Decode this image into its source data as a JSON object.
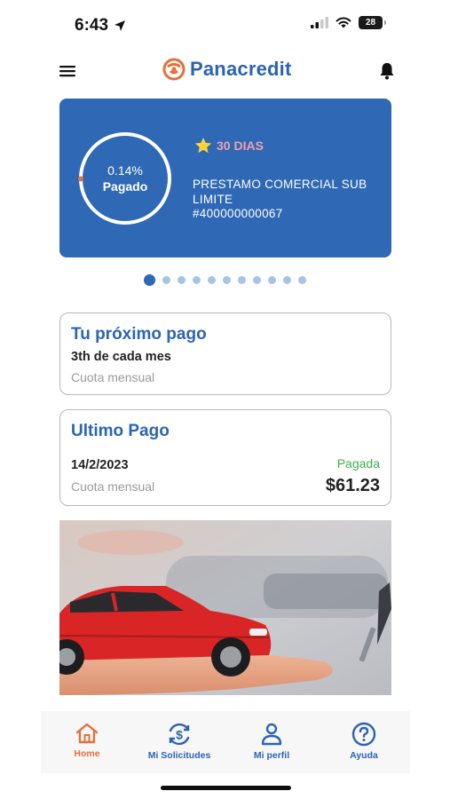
{
  "status_bar": {
    "time": "6:43",
    "battery": "28",
    "icons": [
      "location-arrow-icon",
      "signal-icon",
      "wifi-icon",
      "battery-icon"
    ]
  },
  "header": {
    "brand": "Panacredit",
    "menu_icon": "hamburger-menu-icon",
    "bell_icon": "bell-icon",
    "brand_color": "#2b64b3",
    "logo_color": "#e4703a"
  },
  "loan_card": {
    "percent_text": "0.14%",
    "progress_fraction": 0.0014,
    "status": "Pagado",
    "days": "30 DIAS",
    "name": "PRESTAMO COMERCIAL SUB LIMITE",
    "number": "#400000000067",
    "background": "#2f68b4"
  },
  "carousel": {
    "total": 11,
    "active_index": 0
  },
  "next_payment": {
    "title": "Tu próximo pago",
    "date_text": "3th de cada mes",
    "subtitle": "Cuota mensual"
  },
  "last_payment": {
    "title": "Ultimo Pago",
    "date": "14/2/2023",
    "subtitle": "Cuota mensual",
    "status": "Pagada",
    "amount": "$61.23",
    "status_color": "#3fae49"
  },
  "banner": {
    "image": "red-car-on-hand-photo"
  },
  "bottom_nav": {
    "items": [
      {
        "label": "Home",
        "icon": "home-icon",
        "active": true
      },
      {
        "label": "Mi Solicitudes",
        "icon": "dollar-refresh-icon",
        "active": false
      },
      {
        "label": "Mi perfil",
        "icon": "user-icon",
        "active": false
      },
      {
        "label": "Ayuda",
        "icon": "help-icon",
        "active": false
      }
    ],
    "active_color": "#e4703a",
    "inactive_color": "#2b64b3"
  }
}
